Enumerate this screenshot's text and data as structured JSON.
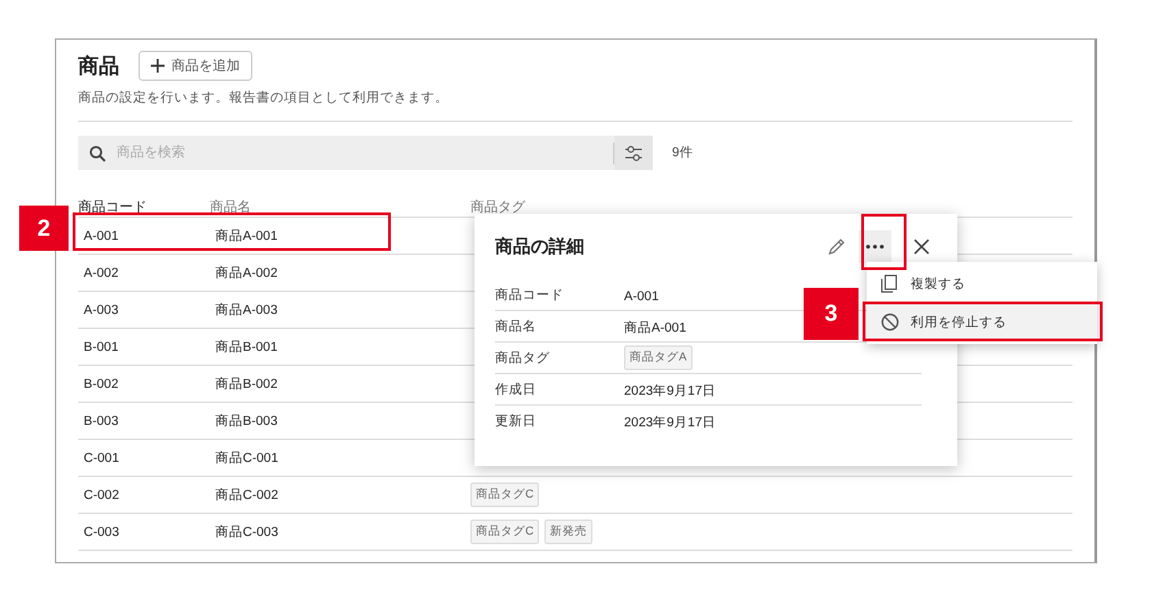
{
  "page": {
    "title": "商品",
    "add_button": "商品を追加",
    "description": "商品の設定を行います。報告書の項目として利用できます。"
  },
  "search": {
    "placeholder": "商品を検索",
    "count": "9件"
  },
  "table": {
    "columns": [
      {
        "label": "商品コード",
        "sorted": true
      },
      {
        "label": "商品名",
        "sorted": false
      },
      {
        "label": "商品タグ",
        "sorted": false
      }
    ],
    "rows": [
      {
        "code": "A-001",
        "name": "商品A-001",
        "tags": []
      },
      {
        "code": "A-002",
        "name": "商品A-002",
        "tags": []
      },
      {
        "code": "A-003",
        "name": "商品A-003",
        "tags": []
      },
      {
        "code": "B-001",
        "name": "商品B-001",
        "tags": []
      },
      {
        "code": "B-002",
        "name": "商品B-002",
        "tags": []
      },
      {
        "code": "B-003",
        "name": "商品B-003",
        "tags": []
      },
      {
        "code": "C-001",
        "name": "商品C-001",
        "tags": []
      },
      {
        "code": "C-002",
        "name": "商品C-002",
        "tags": [
          "商品タグC"
        ]
      },
      {
        "code": "C-003",
        "name": "商品C-003",
        "tags": [
          "商品タグC",
          "新発売"
        ]
      }
    ]
  },
  "detail": {
    "title": "商品の詳細",
    "fields": [
      {
        "label": "商品コード",
        "kind": "text",
        "value": "A-001"
      },
      {
        "label": "商品名",
        "kind": "text",
        "value": "商品A-001"
      },
      {
        "label": "商品タグ",
        "kind": "tags",
        "tags": [
          "商品タグA"
        ]
      },
      {
        "label": "作成日",
        "kind": "text",
        "value": "2023年9月17日"
      },
      {
        "label": "更新日",
        "kind": "text",
        "value": "2023年9月17日"
      }
    ]
  },
  "menu": {
    "items": [
      {
        "label": "複製する",
        "kind": "copy",
        "selected": false
      },
      {
        "label": "利用を停止する",
        "kind": "stop",
        "selected": true
      }
    ]
  },
  "callouts": [
    {
      "label": "2"
    },
    {
      "label": "3"
    }
  ]
}
